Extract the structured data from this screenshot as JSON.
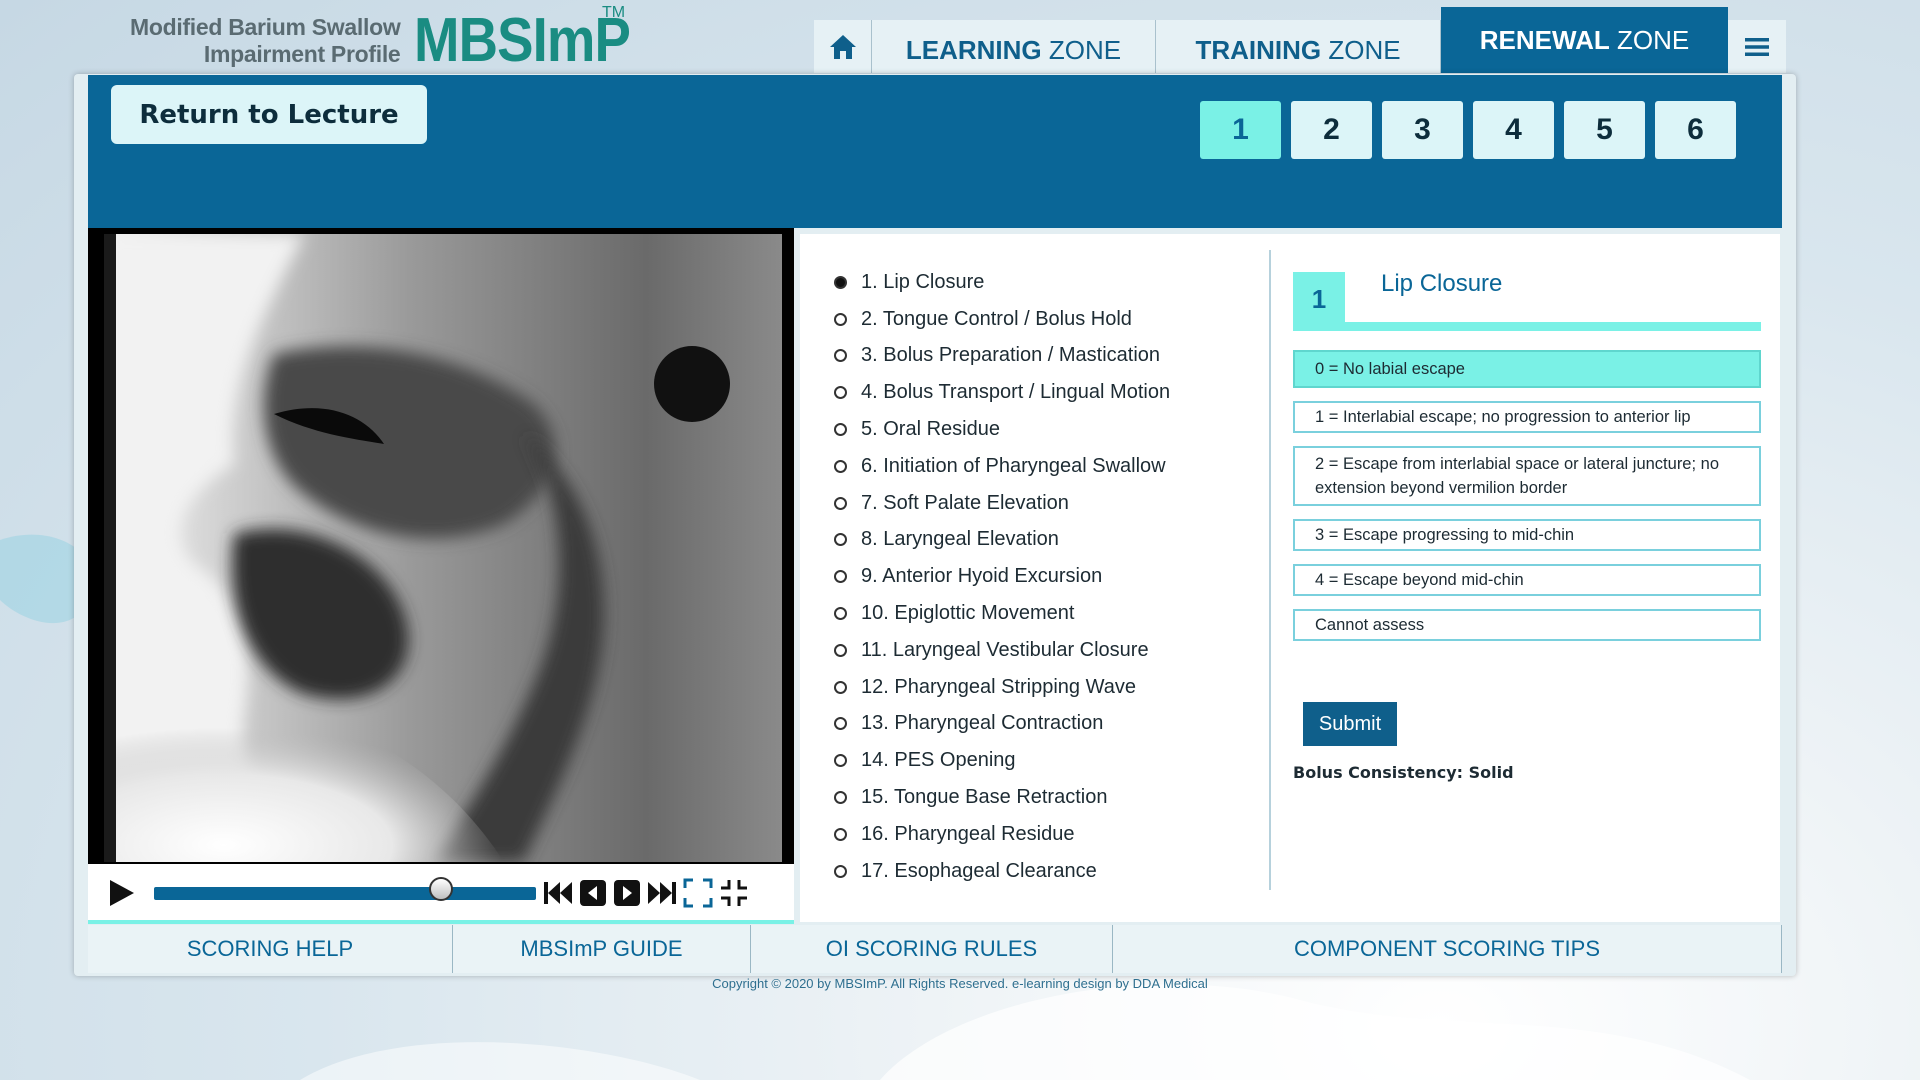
{
  "header": {
    "logo_line1": "Modified Barium Swallow",
    "logo_line2": "Impairment Profile",
    "logo_brand": "MBSImP",
    "logo_tm": "TM"
  },
  "nav": {
    "home_icon": "home-icon",
    "learning_strong": "LEARNING",
    "learning_rest": " ZONE",
    "training_strong": "TRAINING",
    "training_rest": " ZONE",
    "renewal_strong": "RENEWAL",
    "renewal_rest": " ZONE",
    "menu_icon": "hamburger-icon"
  },
  "toolbar": {
    "return_label": "Return to Lecture",
    "pages": [
      "1",
      "2",
      "3",
      "4",
      "5",
      "6"
    ],
    "active_page": "1"
  },
  "video": {
    "progress": 0.75
  },
  "components": [
    "1. Lip Closure",
    "2. Tongue Control / Bolus Hold",
    "3. Bolus Preparation / Mastication",
    "4. Bolus Transport / Lingual Motion",
    "5. Oral Residue",
    "6. Initiation of Pharyngeal Swallow",
    "7. Soft Palate Elevation",
    "8. Laryngeal Elevation",
    "9. Anterior Hyoid Excursion",
    "10. Epiglottic Movement",
    "11. Laryngeal Vestibular Closure",
    "12. Pharyngeal Stripping Wave",
    "13. Pharyngeal Contraction",
    "14. PES Opening",
    "15. Tongue Base Retraction",
    "16. Pharyngeal Residue",
    "17. Esophageal Clearance"
  ],
  "scoring": {
    "number": "1",
    "title": "Lip Closure",
    "options": [
      "0 = No labial escape",
      "1 = Interlabial escape; no progression to anterior lip",
      "2 = Escape from interlabial space or lateral juncture; no extension beyond vermilion border",
      "3 = Escape progressing to mid-chin",
      "4 = Escape beyond mid-chin",
      "Cannot assess"
    ],
    "selected_index": 0,
    "submit_label": "Submit",
    "bolus_label": "Bolus Consistency: Solid"
  },
  "footer": {
    "links": [
      "SCORING HELP",
      "MBSImP GUIDE",
      "OI SCORING RULES",
      "COMPONENT SCORING TIPS"
    ],
    "copyright": "Copyright © 2020 by MBSImP. All Rights Reserved. e-learning design by DDA Medical"
  },
  "colors": {
    "brand_blue": "#0a6697",
    "accent_cyan": "#7af1e6",
    "logo_teal": "#1a8c82"
  }
}
